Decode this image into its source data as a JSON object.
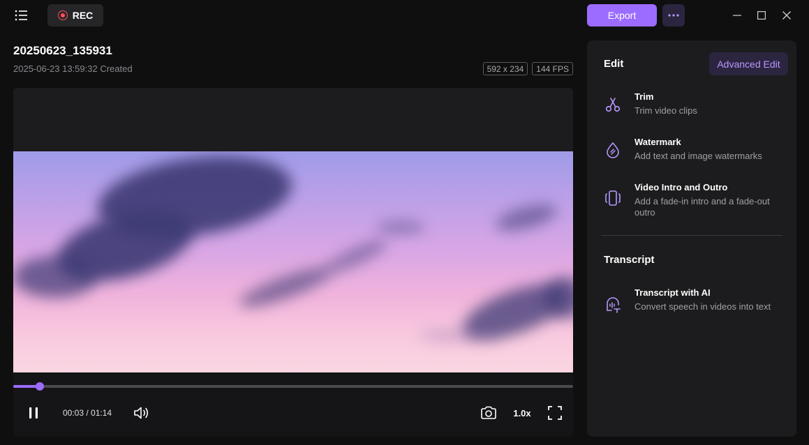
{
  "header": {
    "rec_label": "REC",
    "export_label": "Export"
  },
  "file": {
    "title": "20250623_135931",
    "created": "2025-06-23 13:59:32 Created",
    "resolution": "592 x 234",
    "fps": "144 FPS"
  },
  "player": {
    "current_time": "00:03",
    "separator": "/",
    "duration": "01:14",
    "time_display": "00:03 / 01:14",
    "progress": 0.047,
    "speed": "1.0x"
  },
  "panel": {
    "edit_title": "Edit",
    "advanced_edit_label": "Advanced Edit",
    "tools": [
      {
        "icon": "scissors-icon",
        "name": "Trim",
        "desc": "Trim video clips"
      },
      {
        "icon": "watermark-drop-icon",
        "name": "Watermark",
        "desc": "Add text and image watermarks"
      },
      {
        "icon": "intro-outro-icon",
        "name": "Video Intro and Outro",
        "desc": "Add a fade-in intro and a fade-out outro"
      }
    ],
    "transcript_title": "Transcript",
    "transcript_tools": [
      {
        "icon": "ai-transcript-icon",
        "name": "Transcript with AI",
        "desc": "Convert speech in videos into text"
      }
    ]
  },
  "colors": {
    "accent": "#9b6cff",
    "accent_dark": "#2c2540",
    "rec_red": "#ff4d5e",
    "panel_bg": "#1c1c1e",
    "app_bg": "#0f0f10"
  }
}
